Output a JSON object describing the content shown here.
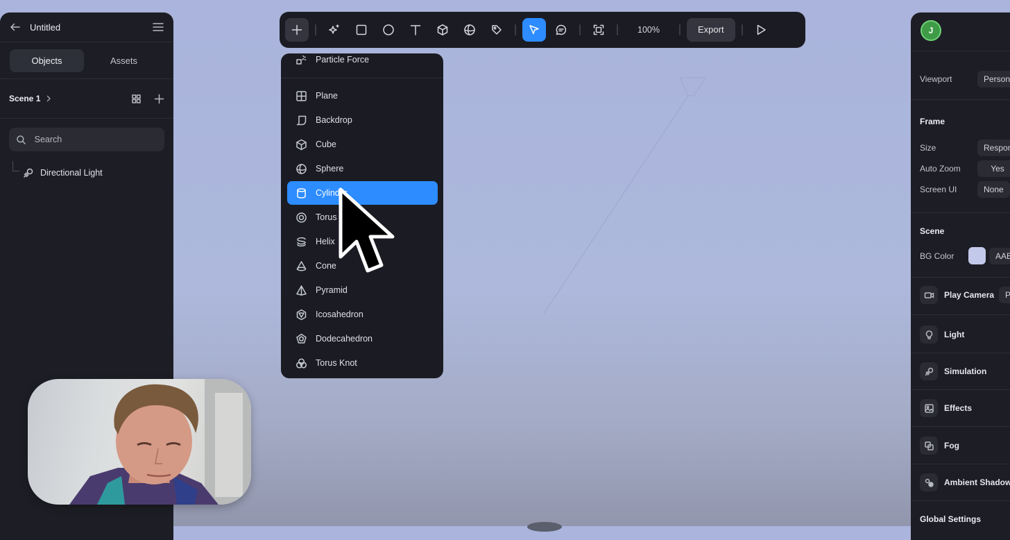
{
  "left_panel": {
    "title": "Untitled",
    "tabs": [
      "Objects",
      "Assets"
    ],
    "scene_name": "Scene 1",
    "search_placeholder": "Search",
    "tree_items": [
      {
        "label": "Directional Light",
        "icon": "directional-light-icon"
      }
    ]
  },
  "toolbar": {
    "zoom": "100%",
    "export_label": "Export",
    "tools": [
      "add",
      "sparkles",
      "rectangle",
      "ellipse",
      "text",
      "cube",
      "sphere",
      "pen",
      "select",
      "comment",
      "frame",
      "play"
    ],
    "active_tool": "select"
  },
  "menu": {
    "items": [
      {
        "label": "Particle Force",
        "icon": "particle-force-icon"
      },
      {
        "label": "Plane",
        "icon": "plane-icon"
      },
      {
        "label": "Backdrop",
        "icon": "backdrop-icon"
      },
      {
        "label": "Cube",
        "icon": "cube-icon"
      },
      {
        "label": "Sphere",
        "icon": "sphere-icon"
      },
      {
        "label": "Cylinder",
        "icon": "cylinder-icon"
      },
      {
        "label": "Torus",
        "icon": "torus-icon"
      },
      {
        "label": "Helix",
        "icon": "helix-icon"
      },
      {
        "label": "Cone",
        "icon": "cone-icon"
      },
      {
        "label": "Pyramid",
        "icon": "pyramid-icon"
      },
      {
        "label": "Icosahedron",
        "icon": "icosahedron-icon"
      },
      {
        "label": "Dodecahedron",
        "icon": "dodecahedron-icon"
      },
      {
        "label": "Torus Knot",
        "icon": "torus-knot-icon"
      }
    ],
    "selected": "Cylinder"
  },
  "right_panel": {
    "avatar_initial": "J",
    "viewport": {
      "label": "Viewport",
      "value": "Personal"
    },
    "frame": {
      "heading": "Frame",
      "rows": [
        {
          "label": "Size",
          "value": "Responsi"
        },
        {
          "label": "Auto Zoom",
          "value": "Yes"
        },
        {
          "label": "Screen UI",
          "value": "None"
        }
      ]
    },
    "scene": {
      "heading": "Scene",
      "bg_color_label": "BG Color",
      "bg_color_value": "AAB",
      "bg_swatch": "#c3c9ea"
    },
    "sections": [
      {
        "label": "Play Camera",
        "icon": "camera-icon",
        "value": "P"
      },
      {
        "label": "Light",
        "icon": "lightbulb-icon"
      },
      {
        "label": "Simulation",
        "icon": "simulation-icon"
      },
      {
        "label": "Effects",
        "icon": "image-icon"
      },
      {
        "label": "Fog",
        "icon": "fog-icon"
      },
      {
        "label": "Ambient Shadow",
        "icon": "ambient-shadow-icon"
      }
    ],
    "global_settings": "Global Settings"
  },
  "colors": {
    "accent": "#2d8cff",
    "panel": "#1d1e25",
    "canvas_bg": "#aab4dc"
  }
}
